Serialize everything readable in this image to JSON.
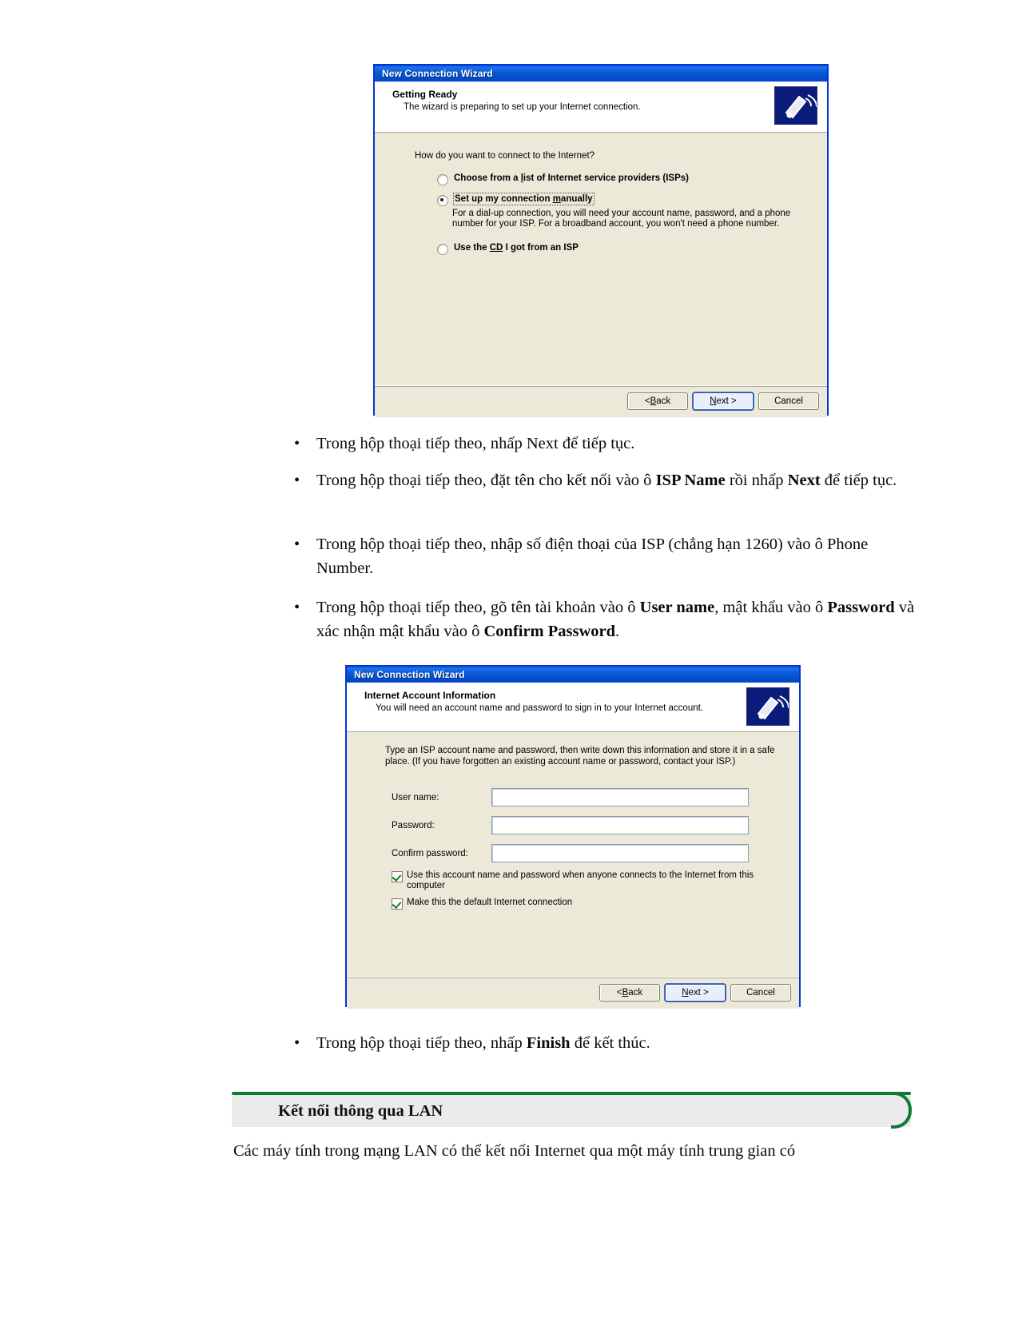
{
  "document": {
    "bullets": [
      {
        "id": "b1",
        "parts": [
          {
            "t": "Trong hộp thoại tiếp theo, nhấp Next để tiếp tục.",
            "b": false
          }
        ]
      },
      {
        "id": "b2",
        "parts": [
          {
            "t": "Trong hộp thoại tiếp theo, đặt tên cho kết nối vào ô ",
            "b": false
          },
          {
            "t": "ISP Name",
            "b": true
          },
          {
            "t": " rồi nhấp ",
            "b": false
          },
          {
            "t": "Next",
            "b": true
          },
          {
            "t": " để tiếp tục.",
            "b": false
          }
        ]
      },
      {
        "id": "b3",
        "parts": [
          {
            "t": "Trong hộp thoại tiếp theo, nhập số điện thoại của ISP (chẳng hạn 1260) vào ô Phone Number.",
            "b": false
          }
        ]
      },
      {
        "id": "b4",
        "parts": [
          {
            "t": "Trong hộp thoại tiếp theo, gõ tên tài khoản vào ô ",
            "b": false
          },
          {
            "t": "User name",
            "b": true
          },
          {
            "t": ", mật khẩu vào ô ",
            "b": false
          },
          {
            "t": "Password",
            "b": true
          },
          {
            "t": " và xác nhận mật khẩu vào ô ",
            "b": false
          },
          {
            "t": "Confirm Password",
            "b": true
          },
          {
            "t": ".",
            "b": false
          }
        ]
      },
      {
        "id": "b5",
        "parts": [
          {
            "t": "Trong hộp thoại tiếp theo, nhấp ",
            "b": false
          },
          {
            "t": "Finish",
            "b": true
          },
          {
            "t": " để kết thúc.",
            "b": false
          }
        ]
      }
    ],
    "section_heading": "Kết nối thông qua LAN",
    "closing_paragraph": "Các máy tính trong mạng LAN có thể kết nối Internet qua một máy tính trung gian có",
    "accent_color": "#0f7a34",
    "heading_bg": "#ebebeb"
  },
  "dialog1": {
    "title": "New Connection Wizard",
    "header_title": "Getting Ready",
    "header_subtitle": "The wizard is preparing to set up your Internet connection.",
    "icon": "network-connection-icon",
    "question": "How do you want to connect to the Internet?",
    "options": [
      {
        "label_pre": "Choose from a ",
        "accel": "l",
        "label_post": "ist of Internet service providers (ISPs)",
        "selected": false,
        "focused": false,
        "description": null
      },
      {
        "label_pre": "Set up my connection ",
        "accel": "m",
        "label_post": "anually",
        "selected": true,
        "focused": true,
        "description": "For a dial-up connection, you will need your account name, password, and a phone number for your ISP. For a broadband account, you won't need a phone number."
      },
      {
        "label_pre": "Use the ",
        "accel": "CD",
        "label_post": " I got from an ISP",
        "selected": false,
        "focused": false,
        "description": null
      }
    ],
    "buttons": {
      "back": {
        "pre": "< ",
        "accel": "B",
        "post": "ack",
        "default": false
      },
      "next": {
        "pre": "",
        "accel": "N",
        "post": "ext >",
        "default": true
      },
      "cancel": {
        "pre": "Cancel",
        "accel": "",
        "post": "",
        "default": false
      }
    },
    "titlebar_color": "#0a5ad6",
    "border_color": "#0831d9",
    "face_color": "#ece9d8"
  },
  "dialog2": {
    "title": "New Connection Wizard",
    "header_title": "Internet Account Information",
    "header_subtitle": "You will need an account name and password to sign in to your Internet account.",
    "icon": "network-connection-icon",
    "intro": "Type an ISP account name and password, then write down this information and store it in a safe place. (If you have forgotten an existing account name or password, contact your ISP.)",
    "fields": [
      {
        "label_pre": "U",
        "accel": "U",
        "label": "User name:",
        "value": "",
        "placeholder": ""
      },
      {
        "label": "Password:",
        "accel": "P",
        "value": "",
        "placeholder": ""
      },
      {
        "label": "Confirm password:",
        "accel": "C",
        "value": "",
        "placeholder": ""
      }
    ],
    "checkboxes": [
      {
        "label": "Use this account  name and password when anyone connects to the Internet from this computer",
        "checked": true,
        "accel": "s"
      },
      {
        "label": "Make this the default Internet connection",
        "checked": true,
        "accel": "M"
      }
    ],
    "buttons": {
      "back": {
        "pre": "< ",
        "accel": "B",
        "post": "ack",
        "default": false
      },
      "next": {
        "pre": "",
        "accel": "N",
        "post": "ext >",
        "default": true
      },
      "cancel": {
        "pre": "Cancel",
        "accel": "",
        "post": "",
        "default": false
      }
    }
  }
}
